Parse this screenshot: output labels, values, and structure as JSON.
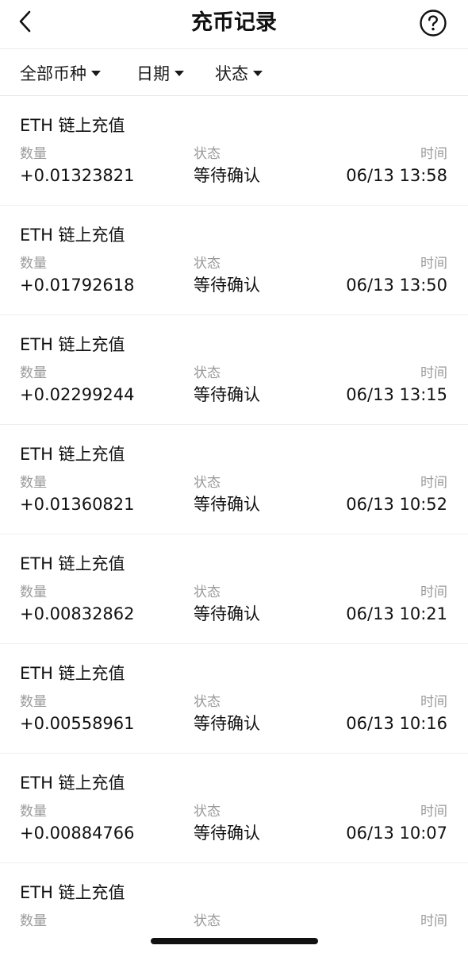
{
  "nav": {
    "title": "充币记录",
    "back_icon": "chevron-left-icon",
    "help_icon": "question-circle-icon"
  },
  "filters": [
    {
      "label": "全部币种"
    },
    {
      "label": "日期"
    },
    {
      "label": "状态"
    }
  ],
  "labels": {
    "amount": "数量",
    "status": "状态",
    "time": "时间"
  },
  "records": [
    {
      "title": "ETH 链上充值",
      "amount": "+0.01323821",
      "status": "等待确认",
      "time": "06/13 13:58"
    },
    {
      "title": "ETH 链上充值",
      "amount": "+0.01792618",
      "status": "等待确认",
      "time": "06/13 13:50"
    },
    {
      "title": "ETH 链上充值",
      "amount": "+0.02299244",
      "status": "等待确认",
      "time": "06/13 13:15"
    },
    {
      "title": "ETH 链上充值",
      "amount": "+0.01360821",
      "status": "等待确认",
      "time": "06/13 10:52"
    },
    {
      "title": "ETH 链上充值",
      "amount": "+0.00832862",
      "status": "等待确认",
      "time": "06/13 10:21"
    },
    {
      "title": "ETH 链上充值",
      "amount": "+0.00558961",
      "status": "等待确认",
      "time": "06/13 10:16"
    },
    {
      "title": "ETH 链上充值",
      "amount": "+0.00884766",
      "status": "等待确认",
      "time": "06/13 10:07"
    },
    {
      "title": "ETH 链上充值",
      "amount": "",
      "status": "",
      "time": ""
    }
  ]
}
